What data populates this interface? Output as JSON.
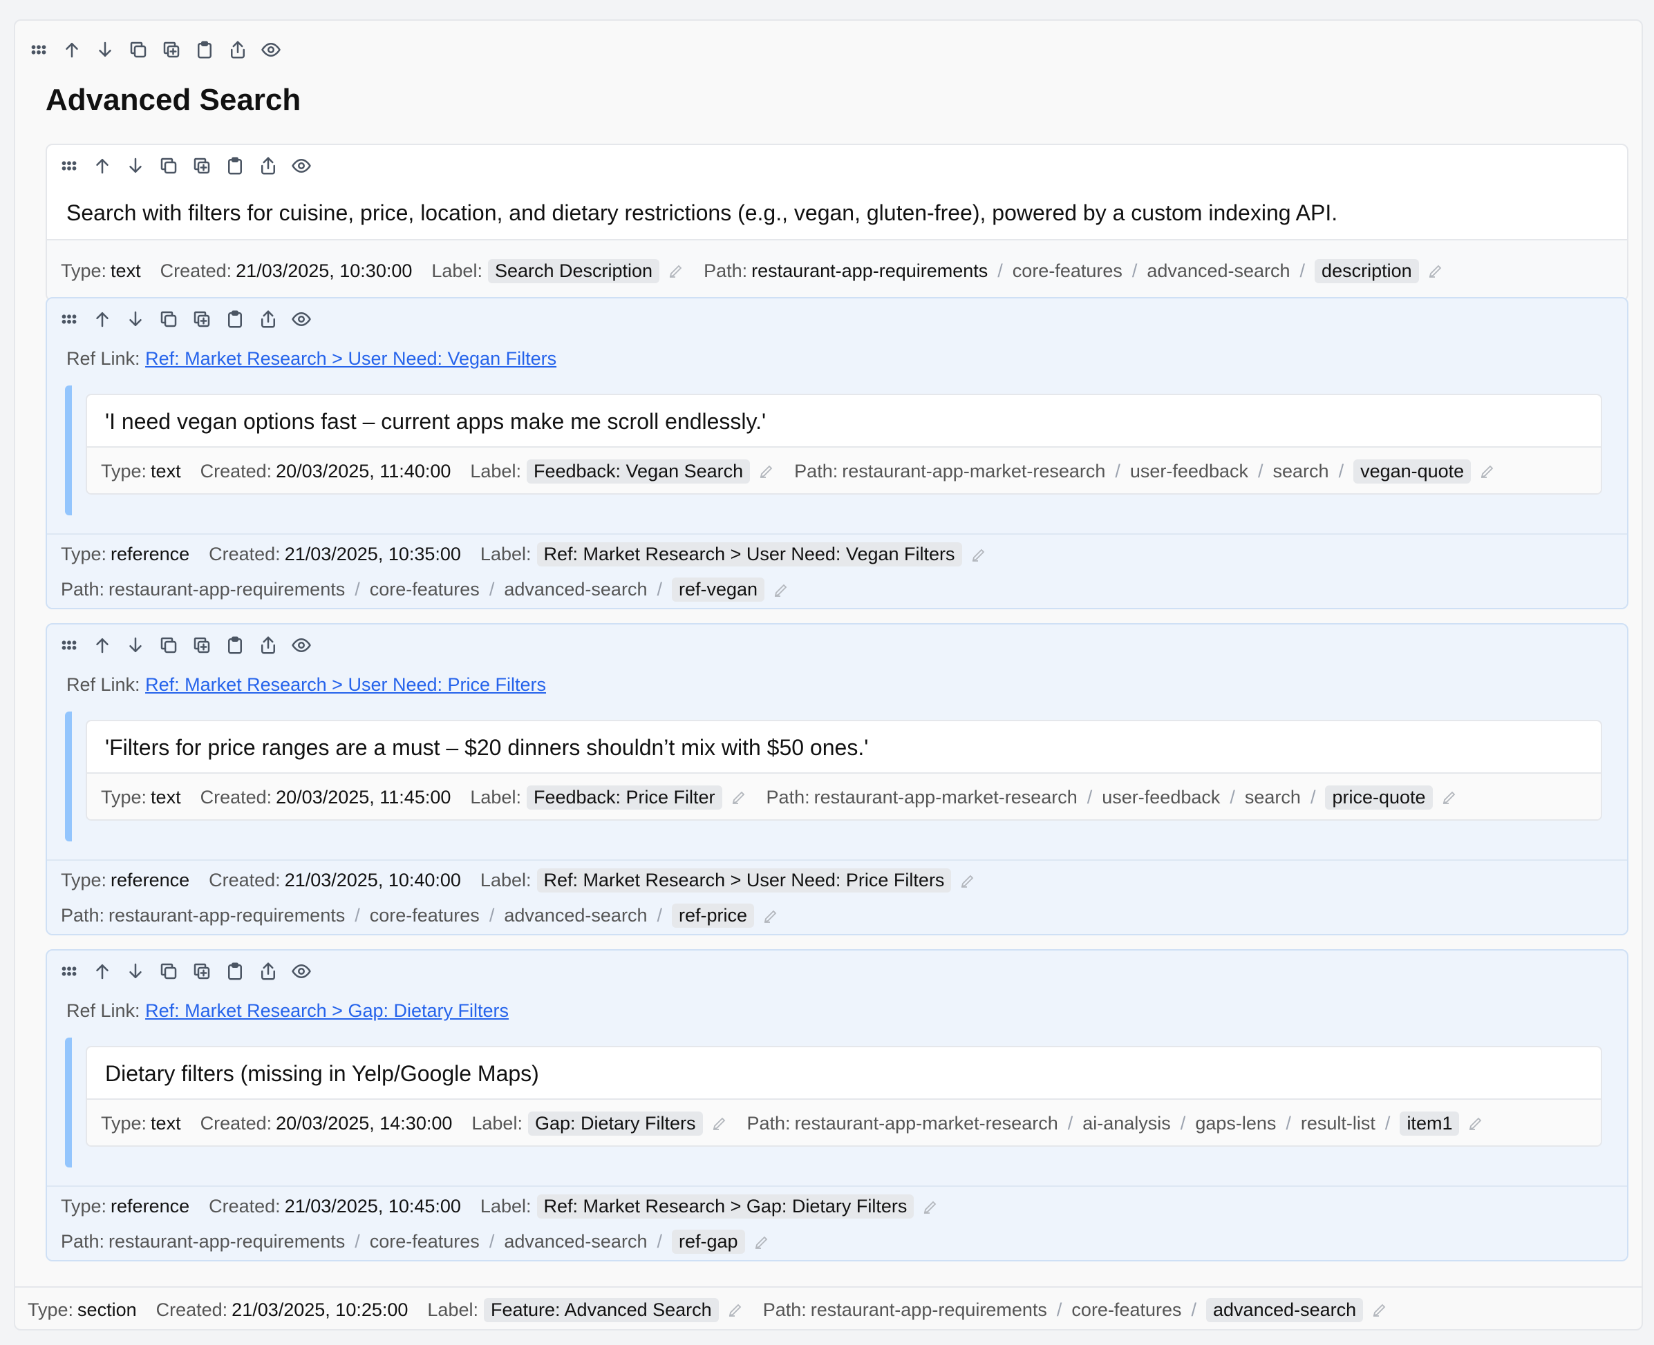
{
  "section": {
    "title": "Advanced Search",
    "footer": {
      "type_label": "Type:",
      "type": "section",
      "created_label": "Created:",
      "created": "21/03/2025, 10:25:00",
      "label_label": "Label:",
      "label": "Feature: Advanced Search",
      "path_label": "Path:",
      "path": [
        "restaurant-app-requirements",
        "core-features"
      ],
      "path_last": "advanced-search"
    }
  },
  "desc_block": {
    "text": "Search with filters for cuisine, price, location, and dietary restrictions (e.g., vegan, gluten-free), powered by a custom indexing API.",
    "type": "text",
    "created": "21/03/2025, 10:30:00",
    "label": "Search Description",
    "path": [
      "restaurant-app-requirements",
      "core-features",
      "advanced-search"
    ],
    "path_last": "description"
  },
  "refs": [
    {
      "link_label": "Ref Link:",
      "link": "Ref: Market Research > User Need: Vegan Filters",
      "quote": {
        "text": "'I need vegan options fast – current apps make me scroll endlessly.'",
        "type": "text",
        "created": "20/03/2025, 11:40:00",
        "label": "Feedback: Vegan Search",
        "path": [
          "restaurant-app-market-research",
          "user-feedback",
          "search"
        ],
        "path_last": "vegan-quote"
      },
      "meta": {
        "type": "reference",
        "created": "21/03/2025, 10:35:00",
        "label": "Ref: Market Research > User Need: Vegan Filters",
        "path": [
          "restaurant-app-requirements",
          "core-features",
          "advanced-search"
        ],
        "path_last": "ref-vegan"
      }
    },
    {
      "link_label": "Ref Link:",
      "link": "Ref: Market Research > User Need: Price Filters",
      "quote": {
        "text": "'Filters for price ranges are a must – $20 dinners shouldn’t mix with $50 ones.'",
        "type": "text",
        "created": "20/03/2025, 11:45:00",
        "label": "Feedback: Price Filter",
        "path": [
          "restaurant-app-market-research",
          "user-feedback",
          "search"
        ],
        "path_last": "price-quote"
      },
      "meta": {
        "type": "reference",
        "created": "21/03/2025, 10:40:00",
        "label": "Ref: Market Research > User Need: Price Filters",
        "path": [
          "restaurant-app-requirements",
          "core-features",
          "advanced-search"
        ],
        "path_last": "ref-price"
      }
    },
    {
      "link_label": "Ref Link:",
      "link": "Ref: Market Research > Gap: Dietary Filters",
      "quote": {
        "text": "Dietary filters (missing in Yelp/Google Maps)",
        "type": "text",
        "created": "20/03/2025, 14:30:00",
        "label": "Gap: Dietary Filters",
        "path": [
          "restaurant-app-market-research",
          "ai-analysis",
          "gaps-lens",
          "result-list"
        ],
        "path_last": "item1"
      },
      "meta": {
        "type": "reference",
        "created": "21/03/2025, 10:45:00",
        "label": "Ref: Market Research > Gap: Dietary Filters",
        "path": [
          "restaurant-app-requirements",
          "core-features",
          "advanced-search"
        ],
        "path_last": "ref-gap"
      }
    }
  ],
  "labels": {
    "type": "Type:",
    "created": "Created:",
    "label": "Label:",
    "path": "Path:",
    "sep": "/"
  },
  "toolbar_icons": [
    "drag-handle-icon",
    "move-up-icon",
    "move-down-icon",
    "copy-icon",
    "duplicate-icon",
    "clipboard-icon",
    "export-icon",
    "eye-icon"
  ]
}
